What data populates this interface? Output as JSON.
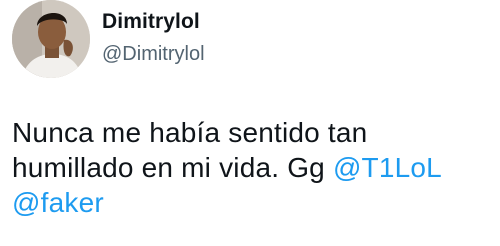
{
  "user": {
    "display_name": "Dimitrylol",
    "handle": "@Dimitrylol"
  },
  "tweet": {
    "line1": "Nunca me había sentido tan",
    "line2_text": "humillado en mi vida. Gg ",
    "mention1": "@T1LoL",
    "mention2": "@faker"
  },
  "colors": {
    "mention": "#1d9bf0",
    "handle": "#536471",
    "text": "#0f1419"
  }
}
